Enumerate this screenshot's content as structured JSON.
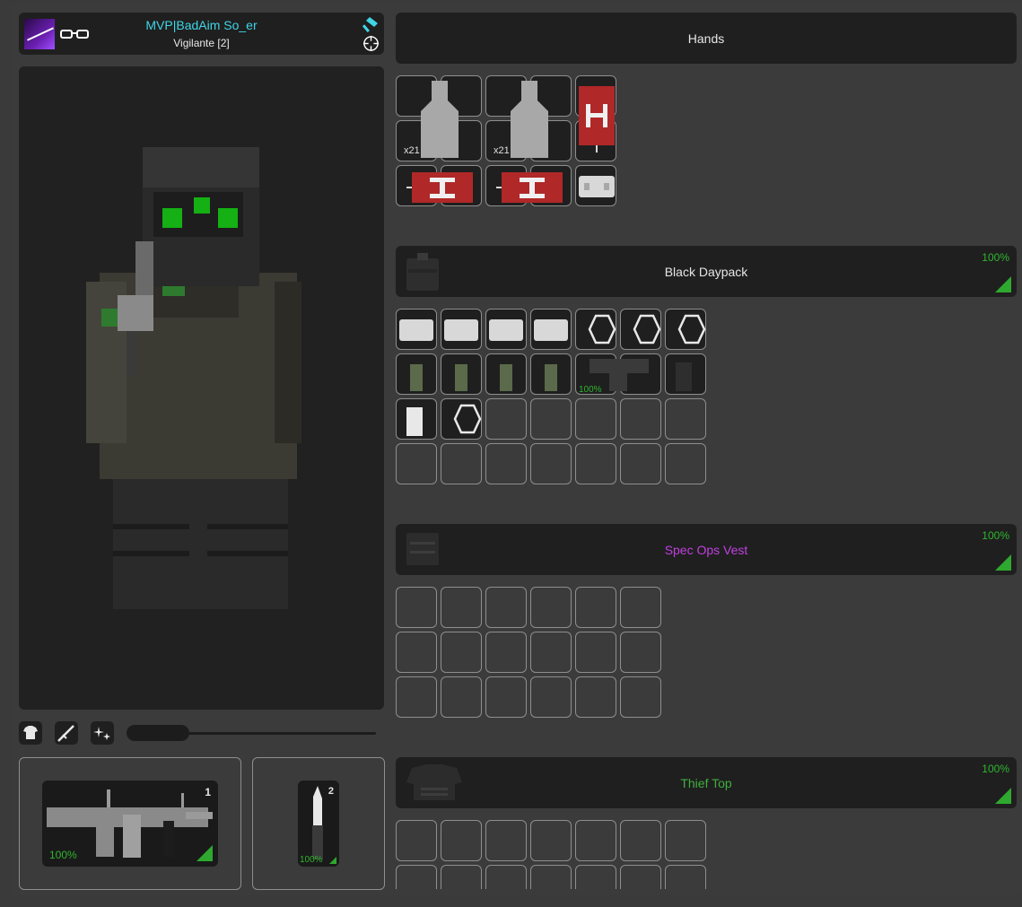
{
  "player": {
    "name": "MVP|BadAim So_er",
    "rank": "Vigilante [2]",
    "name_color": "#3fd6e6"
  },
  "loadout": {
    "primary": {
      "slot": "1",
      "quality": "100%"
    },
    "secondary": {
      "slot": "2",
      "quality": "100%"
    }
  },
  "hands": {
    "title": "Hands",
    "stacks": [
      "x21",
      "x21"
    ]
  },
  "backpack": {
    "title": "Black Daypack",
    "quality": "100%",
    "item_quality": "100%"
  },
  "vest": {
    "title": "Spec Ops Vest",
    "quality": "100%",
    "title_color": "#c040e0"
  },
  "shirt": {
    "title": "Thief Top",
    "quality": "100%",
    "title_color": "#3fae3f"
  },
  "colors": {
    "quality_green": "#2fb52f",
    "panel_bg": "#1f1f1f",
    "grid_border": "#8e8e8e"
  }
}
